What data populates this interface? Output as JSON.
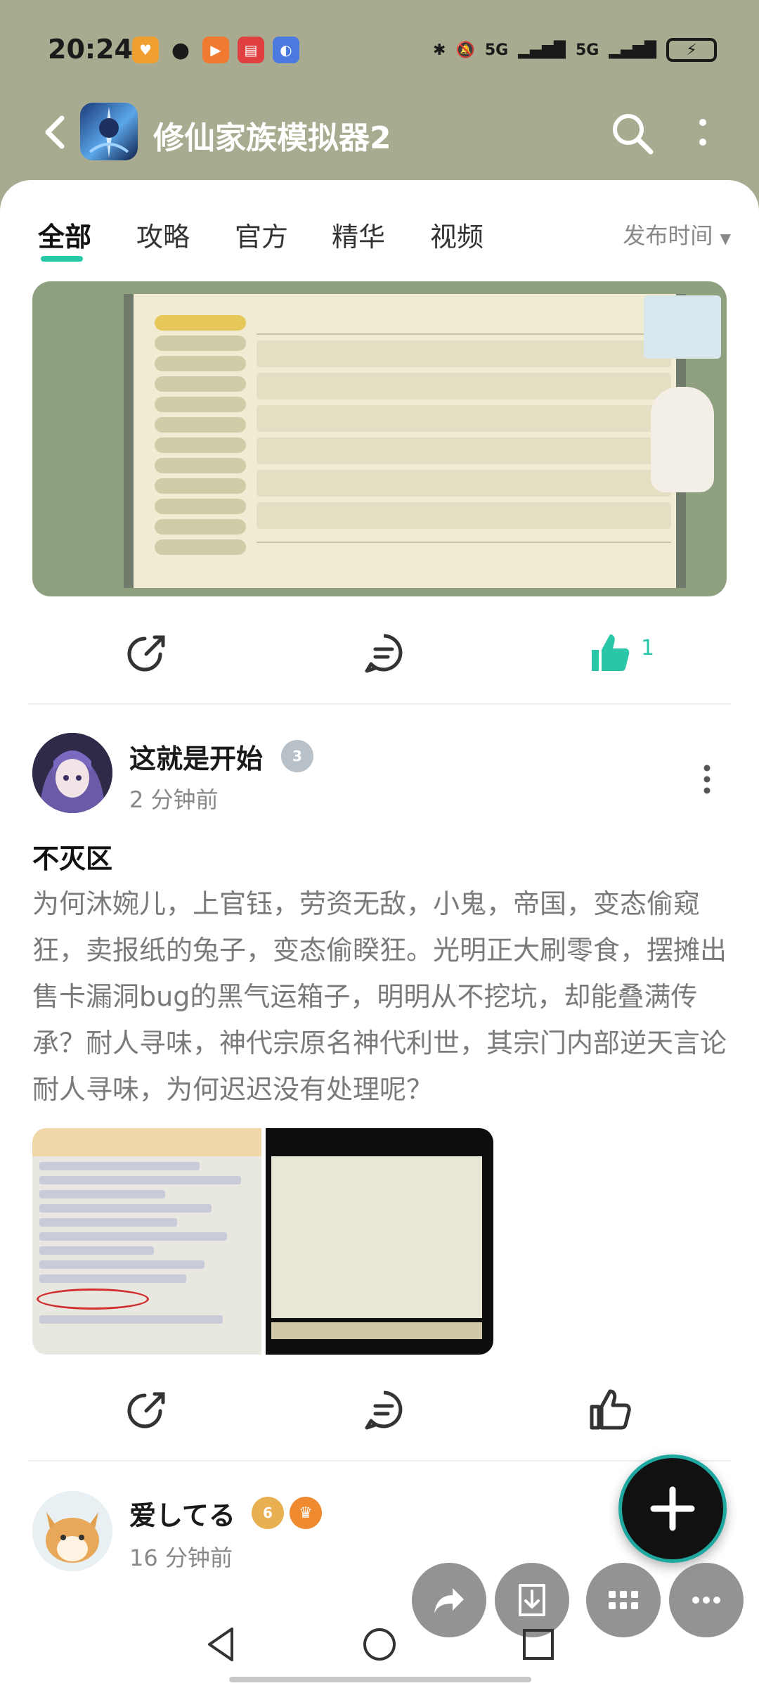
{
  "status_bar": {
    "time": "20:24",
    "network": "5G"
  },
  "app_bar": {
    "title": "修仙家族模拟器2"
  },
  "tabs": [
    "全部",
    "攻略",
    "官方",
    "精华",
    "视频"
  ],
  "sort": {
    "label": "发布时间"
  },
  "post1": {
    "like_count": "1"
  },
  "post2": {
    "author": "这就是开始",
    "level_badge": "3",
    "time": "2 分钟前",
    "title": "不灭区",
    "body": "为何沐婉儿，上官钰，劳资无敌，小鬼，帝国，变态偷窥狂，卖报纸的兔子，变态偷睽狂。光明正大刷零食，摆摊出售卡漏洞bug的黑气运箱子，明明从不挖坑，却能叠满传承？耐人寻味，神代宗原名神代利世，其宗门内部逆天言论耐人寻味，为何迟迟没有处理呢？"
  },
  "post3": {
    "author": "爱してる",
    "level_badge": "6",
    "time": "16 分钟前"
  },
  "colors": {
    "accent": "#29c7a8",
    "header_bg": "#a8ab8f"
  }
}
